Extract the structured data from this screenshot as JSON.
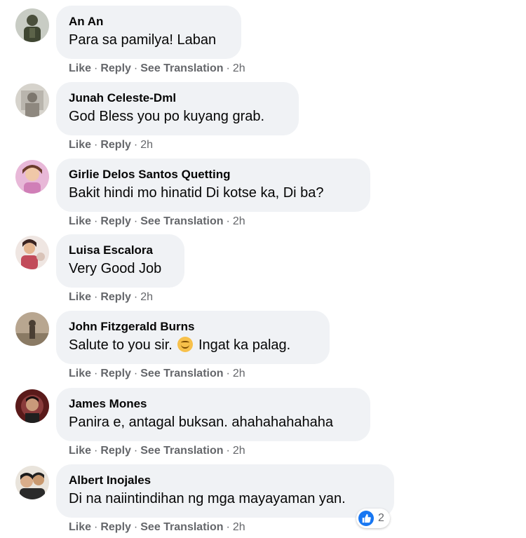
{
  "actions": {
    "like": "Like",
    "reply": "Reply",
    "translate": "See Translation",
    "dot": "·"
  },
  "comments": [
    {
      "author": "An An",
      "text": "Para sa pamilya! Laban",
      "time": "2h"
    },
    {
      "author": "Junah Celeste-Dml",
      "text": "God Bless you po kuyang grab.",
      "time": "2h"
    },
    {
      "author": "Girlie Delos Santos Quetting",
      "text": "Bakit hindi mo hinatid Di kotse ka, Di ba?",
      "time": "2h"
    },
    {
      "author": "Luisa Escalora",
      "text": "Very Good Job",
      "time": "2h"
    },
    {
      "author": "John Fitzgerald Burns",
      "text_before": "Salute to you sir.",
      "text_after": "Ingat ka palag.",
      "time": "2h"
    },
    {
      "author": "James Mones",
      "text": "Panira e, antagal buksan. ahahahahahaha",
      "time": "2h"
    },
    {
      "author": "Albert Inojales",
      "text": "Di na naiintindihan ng mga mayayaman yan.",
      "time": "2h",
      "reaction_count": "2"
    }
  ],
  "colors": {
    "bubble": "#f0f2f5",
    "meta": "#65676b",
    "like_blue": "#1877f2"
  }
}
